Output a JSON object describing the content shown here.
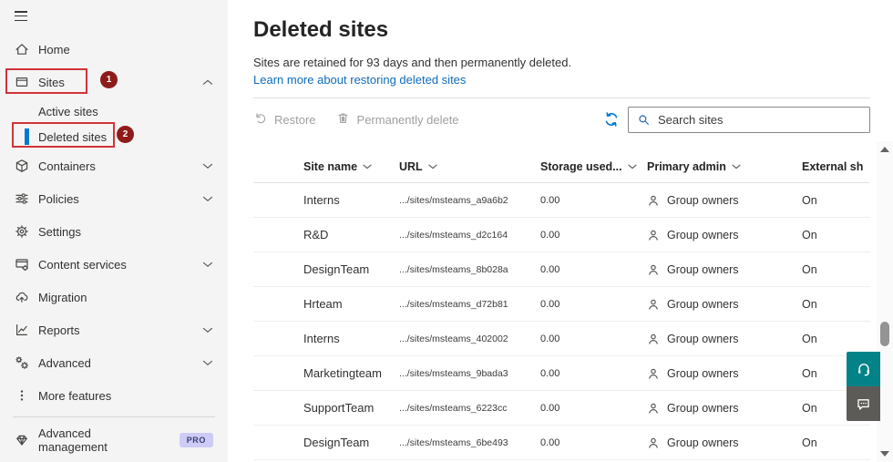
{
  "sidebar": {
    "items": [
      {
        "label": "Home",
        "icon": "home-icon"
      },
      {
        "label": "Sites",
        "icon": "sites-icon",
        "expanded": true
      },
      {
        "label": "Active sites"
      },
      {
        "label": "Deleted sites",
        "selected": true
      },
      {
        "label": "Containers",
        "icon": "container-icon",
        "collapsed": true
      },
      {
        "label": "Policies",
        "icon": "sliders-icon",
        "collapsed": true
      },
      {
        "label": "Settings",
        "icon": "gear-icon"
      },
      {
        "label": "Content services",
        "icon": "content-services-icon",
        "collapsed": true
      },
      {
        "label": "Migration",
        "icon": "cloud-upload-icon"
      },
      {
        "label": "Reports",
        "icon": "line-chart-icon",
        "collapsed": true
      },
      {
        "label": "Advanced",
        "icon": "gears-icon",
        "collapsed": true
      },
      {
        "label": "More features",
        "icon": "ellipsis-icon"
      }
    ],
    "footer": {
      "label": "Advanced management",
      "badge": "PRO",
      "icon": "gem-icon"
    }
  },
  "annotations": {
    "step1": "1",
    "step2": "2"
  },
  "page": {
    "title": "Deleted sites",
    "description": "Sites are retained for 93 days and then permanently deleted.",
    "link": "Learn more about restoring deleted sites"
  },
  "toolbar": {
    "restore_label": "Restore",
    "delete_label": "Permanently delete",
    "search_placeholder": "Search sites"
  },
  "table": {
    "columns": [
      {
        "label": "Site name",
        "sortable": true
      },
      {
        "label": "URL",
        "sortable": true
      },
      {
        "label": "Storage used...",
        "sortable": true
      },
      {
        "label": "Primary admin",
        "sortable": true
      },
      {
        "label": "External sh",
        "sortable": false
      }
    ],
    "rows": [
      {
        "site": "Interns",
        "url": ".../sites/msteams_a9a6b2",
        "storage": "0.00",
        "admin": "Group owners",
        "external": "On"
      },
      {
        "site": "R&D",
        "url": ".../sites/msteams_d2c164",
        "storage": "0.00",
        "admin": "Group owners",
        "external": "On"
      },
      {
        "site": "DesignTeam",
        "url": ".../sites/msteams_8b028a",
        "storage": "0.00",
        "admin": "Group owners",
        "external": "On"
      },
      {
        "site": "Hrteam",
        "url": ".../sites/msteams_d72b81",
        "storage": "0.00",
        "admin": "Group owners",
        "external": "On"
      },
      {
        "site": "Interns",
        "url": ".../sites/msteams_402002",
        "storage": "0.00",
        "admin": "Group owners",
        "external": "On"
      },
      {
        "site": "Marketingteam",
        "url": ".../sites/msteams_9bada3",
        "storage": "0.00",
        "admin": "Group owners",
        "external": "On"
      },
      {
        "site": "SupportTeam",
        "url": ".../sites/msteams_6223cc",
        "storage": "0.00",
        "admin": "Group owners",
        "external": "On"
      },
      {
        "site": "DesignTeam",
        "url": ".../sites/msteams_6be493",
        "storage": "0.00",
        "admin": "Group owners",
        "external": "On"
      }
    ]
  },
  "colors": {
    "accent": "#0078d4",
    "link": "#0f6cbd",
    "annotation_box": "#d13438",
    "annotation_badge": "#8f1a1a",
    "selected_indicator": "#0078d4",
    "help_button": "#038387",
    "feedback_button": "#5d5b57",
    "pro_badge_bg": "#ccccf6",
    "pro_badge_text": "#3d3e78",
    "sidebar_bg": "#f4f4f4"
  }
}
